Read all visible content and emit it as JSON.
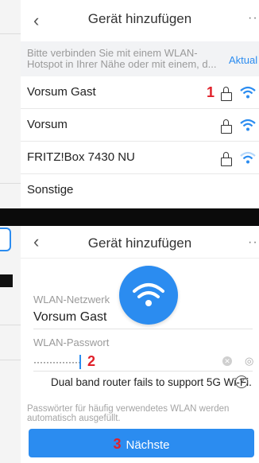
{
  "header1": {
    "back_icon": "chevron-left-icon",
    "title": "Gerät hinzufügen",
    "more": "··"
  },
  "hint": {
    "text": "Bitte verbinden Sie mit einem WLAN-Hotspot in Ihrer Nähe oder mit einem, d...",
    "link": "Aktual"
  },
  "networks": [
    {
      "name": "Vorsum Gast",
      "marker": "1"
    },
    {
      "name": "Vorsum"
    },
    {
      "name": "FRITZ!Box 7430 NU"
    },
    {
      "name": "Sonstige"
    }
  ],
  "header2": {
    "title": "Gerät hinzufügen",
    "more": "··"
  },
  "form": {
    "ssid_label": "WLAN-Netzwerk",
    "ssid_value": "Vorsum Gast",
    "password_label": "WLAN-Passwort",
    "password_mask": "···············",
    "password_marker": "2",
    "dual_band": "Dual band router fails to support 5G Wi-Fi.",
    "help": "?",
    "note": "Passwörter für häufig verwendetes WLAN werden automatisch ausgefüllt.",
    "next_marker": "3",
    "next_label": "Nächste"
  },
  "colors": {
    "accent": "#2b8cf0",
    "marker": "#e0202a"
  },
  "icons": [
    "chevron-left-icon",
    "lock-icon",
    "wifi-icon",
    "clear-icon",
    "eye-icon",
    "help-icon"
  ]
}
